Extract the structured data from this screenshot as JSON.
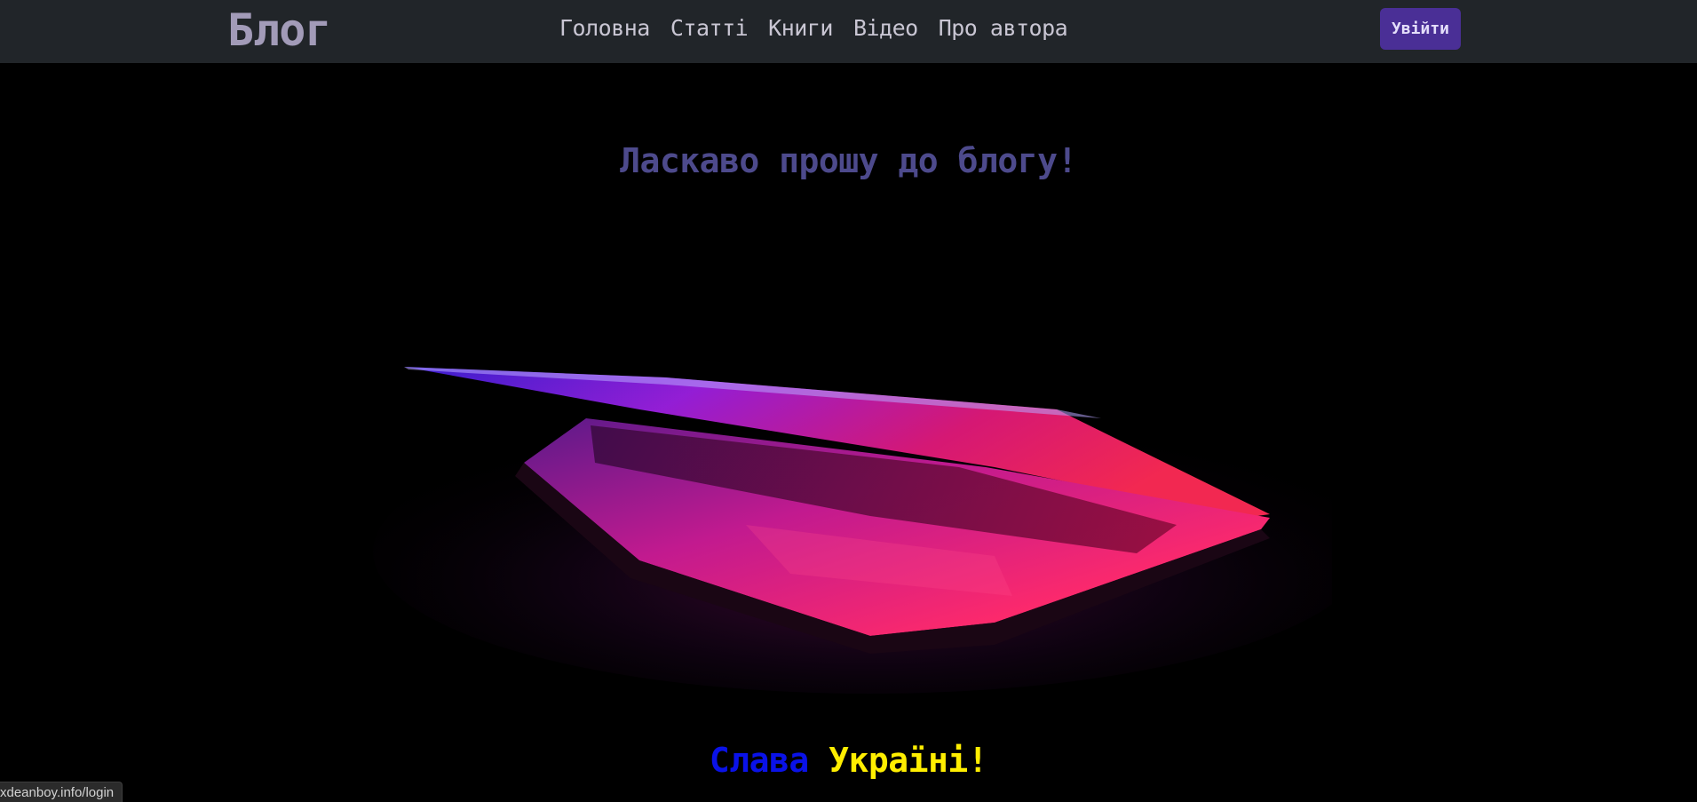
{
  "navbar": {
    "brand": "Блог",
    "links": [
      {
        "label": "Головна"
      },
      {
        "label": "Статті"
      },
      {
        "label": "Книги"
      },
      {
        "label": "Відео"
      },
      {
        "label": "Про автора"
      }
    ],
    "login_label": "Увійти"
  },
  "hero": {
    "title": "Ласкаво прошу до блогу!",
    "slogan_part1": "Слава",
    "slogan_part2": "Україні!",
    "image": "laptop-glow-illustration"
  },
  "status_bar": {
    "url": "xdeanboy.info/login"
  },
  "colors": {
    "navbar_bg": "#212529",
    "brand": "#a29bb8",
    "login_bg": "#4a2f96",
    "title": "#4d4a8c",
    "slogan_blue": "#0a12e8",
    "slogan_yellow": "#ffee00"
  }
}
